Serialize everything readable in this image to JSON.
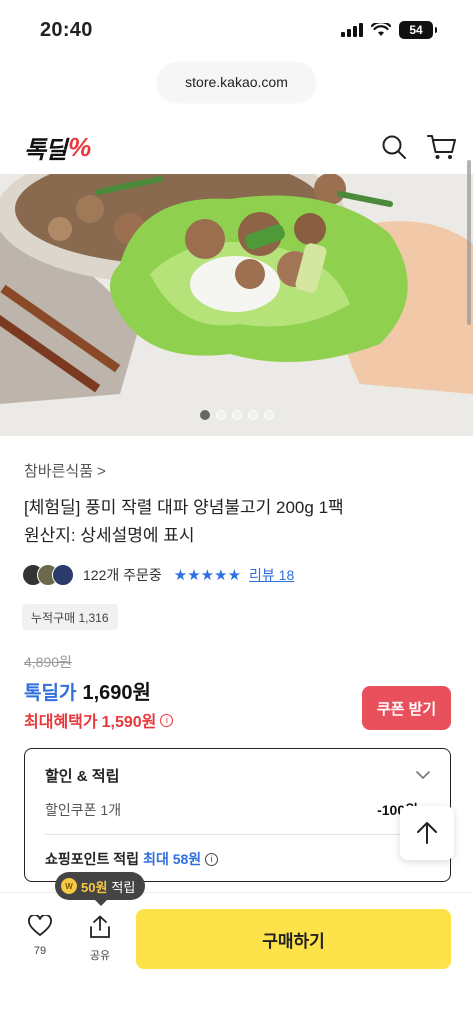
{
  "status_bar": {
    "time": "20:40",
    "battery": "54"
  },
  "browser": {
    "url": "store.kakao.com"
  },
  "header": {
    "logo_text": "톡딜",
    "logo_mark": "%"
  },
  "gallery": {
    "image_alt": "상추쌈 위 양념불고기",
    "page_count": 5,
    "active_index": 0
  },
  "product": {
    "brand": "참바른식품 >",
    "title_line1": "[체험딜] 풍미 작렬 대파 양념불고기 200g 1팩",
    "title_line2": "원산지: 상세설명에 표시",
    "orders": "122개 주문중",
    "stars": "★★★★★",
    "rating": 5,
    "review_label": "리뷰 18",
    "cumulative": "누적구매 1,316"
  },
  "price": {
    "original": "4,890원",
    "deal_label": "톡딜가",
    "deal_price": "1,690원",
    "max_label": "최대혜택가",
    "max_price": "1,590원",
    "coupon_button": "쿠폰 받기"
  },
  "benefits": {
    "title": "할인 & 적립",
    "coupon_label": "할인쿠폰 1개",
    "coupon_value": "-100원",
    "point_label": "쇼핑포인트 적립",
    "point_max_label": "최대 58원"
  },
  "bottom": {
    "like_count": "79",
    "share_label": "공유",
    "tooltip_amount": "50원",
    "tooltip_suffix": "적립",
    "buy_label": "구매하기"
  },
  "colors": {
    "accent_blue": "#2f6fe0",
    "accent_red": "#e8383d",
    "buy_yellow": "#fde24a"
  }
}
